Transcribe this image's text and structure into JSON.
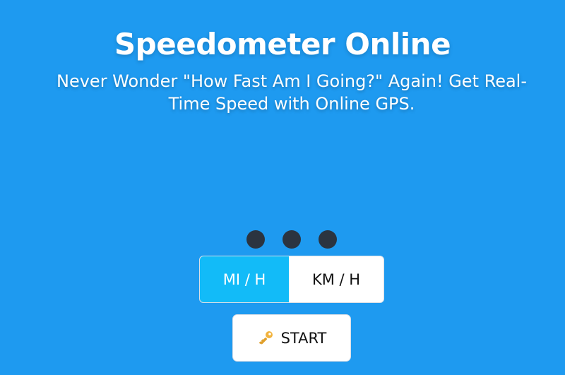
{
  "header": {
    "title": "Speedometer Online",
    "subtitle": "Never Wonder \"How Fast Am I Going?\" Again! Get Real-Time Speed with Online GPS."
  },
  "speed_display": {
    "state": "loading",
    "indicator": "three-dots"
  },
  "units": {
    "options": [
      "MI / H",
      "KM / H"
    ],
    "selected": "MI / H"
  },
  "start_button": {
    "label": "START",
    "icon": "key-icon"
  },
  "colors": {
    "background": "#1e9af0",
    "selected_unit": "#12bbf8",
    "dots": "#2b3440"
  }
}
